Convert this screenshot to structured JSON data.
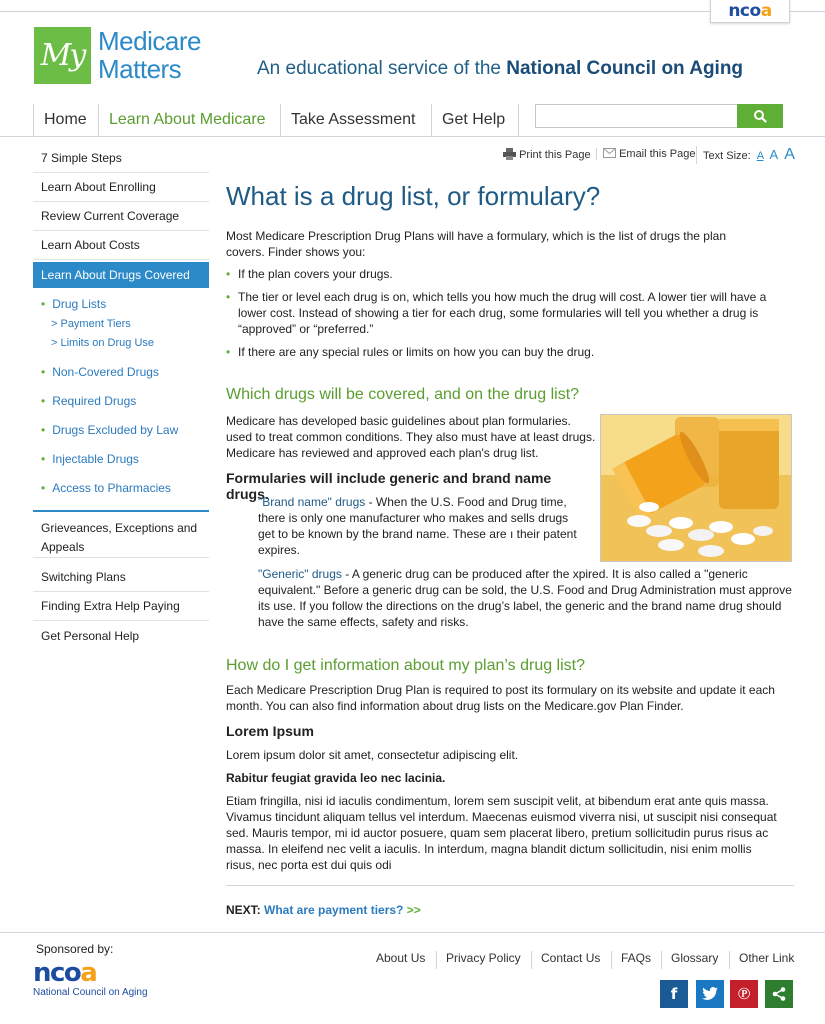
{
  "header": {
    "ncoa_tab": "ncoa",
    "logo": {
      "mark": "My",
      "line1": "Medicare",
      "line2": "Matters"
    },
    "tagline_prefix": "An educational service of the ",
    "tagline_org": "National Council on Aging"
  },
  "nav": {
    "items": [
      "Home",
      "Learn About Medicare",
      "Take Assessment",
      "Get Help"
    ],
    "active_index": 1,
    "search_placeholder": "",
    "search_icon": "search-icon"
  },
  "sidebar": {
    "items_top": [
      "7 Simple Steps",
      "Learn About Enrolling",
      "Review Current Coverage",
      "Learn About Costs"
    ],
    "active": "Learn About Drugs Covered",
    "sub_items": [
      "Drug Lists",
      "Non-Covered Drugs",
      "Required Drugs",
      "Drugs Excluded by Law",
      "Injectable Drugs",
      "Access to Pharmacies"
    ],
    "subsub_items": [
      "> Payment Tiers",
      "> Limits on Drug Use"
    ],
    "items_bottom": [
      "Grieveances, Exceptions and Appeals",
      "Switching Plans",
      "Finding Extra Help Paying",
      "Get Personal Help"
    ]
  },
  "tools": {
    "print": "Print this Page",
    "email": "Email this Page",
    "text_size": "Text Size:",
    "size_a": "A"
  },
  "content": {
    "title": "What is a drug list, or formulary?",
    "intro": "Most Medicare Prescription Drug Plans will have a formulary, which is the list of drugs the plan covers.  Finder shows you:",
    "bullets": [
      "If the plan covers your drugs.",
      "The tier or level each drug is on, which tells you how much the drug will cost.  A lower tier will have a lower cost.  Instead of showing a tier for each drug, some formularies will tell you whether a drug is “approved” or “preferred.”",
      "If there are any special rules or limits on how you can buy the drug."
    ],
    "h2_covered": "Which drugs will be covered, and on the drug list?",
    "covered_para": "Medicare has developed basic guidelines about plan formularies. used to treat common conditions. They also must have at least drugs. Medicare has reviewed and approved each plan's drug list.",
    "h3_formularies": "Formularies will include generic and brand name drugs.",
    "brand_term": "\"Brand name\" drugs",
    "brand_text": " - When the U.S. Food and Drug time, there is only one manufacturer who makes and sells drugs get to be   known by the brand name. These are ı their patent expires.",
    "generic_term": "\"Generic\" drugs",
    "generic_text": " - A generic drug can be produced after the xpired.  It is also called a \"generic equivalent.\"  Before a generic drug can be sold, the U.S. Food and Drug Administration must approve its use. If you follow the directions on the drug’s label, the generic and the brand name drug should have the same effects, safety and risks.",
    "h2_info": "How do I get information about my plan’s drug list?",
    "info_para": "Each Medicare Prescription Drug Plan is required to post its formulary on its website and update it each month. You can also find information about drug lists on the Medicare.gov Plan Finder.",
    "h3_lorem": "Lorem Ipsum",
    "lorem_1": "Lorem ipsum dolor sit amet, consectetur adipiscing elit.",
    "lorem_bold": "Rabitur feugiat gravida leo nec lacinia.",
    "lorem_2": "Etiam fringilla, nisi id iaculis condimentum, lorem sem suscipit velit, at bibendum erat ante quis massa. Vivamus tincidunt aliquam tellus vel interdum. Maecenas euismod viverra nisi, ut suscipit nisi consequat sed. Mauris tempor, mi id auctor posuere, quam sem placerat libero, pretium sollicitudin purus risus ac massa. In eleifend nec velit a iaculis. In interdum, magna blandit dictum sollicitudin, nisi enim mollis risus, nec porta est dui quis odi",
    "next_label": "NEXT:",
    "next_link": "What are payment tiers?",
    "next_arrows": ">>"
  },
  "footer": {
    "sponsored": "Sponsored by:",
    "ncoa_name": "National Council on Aging",
    "links": [
      "About Us",
      "Privacy Policy",
      "Contact Us",
      "FAQs",
      "Glossary",
      "Other Link"
    ],
    "social": [
      "facebook-icon",
      "twitter-icon",
      "pinterest-icon",
      "share-icon"
    ]
  },
  "colors": {
    "brand_blue": "#2c8ac8",
    "brand_green": "#5fae36",
    "title_blue": "#1f5a85",
    "facebook": "#1a5a96",
    "twitter": "#1a78c2",
    "pinterest": "#c3202b",
    "share": "#2f7d2f"
  }
}
